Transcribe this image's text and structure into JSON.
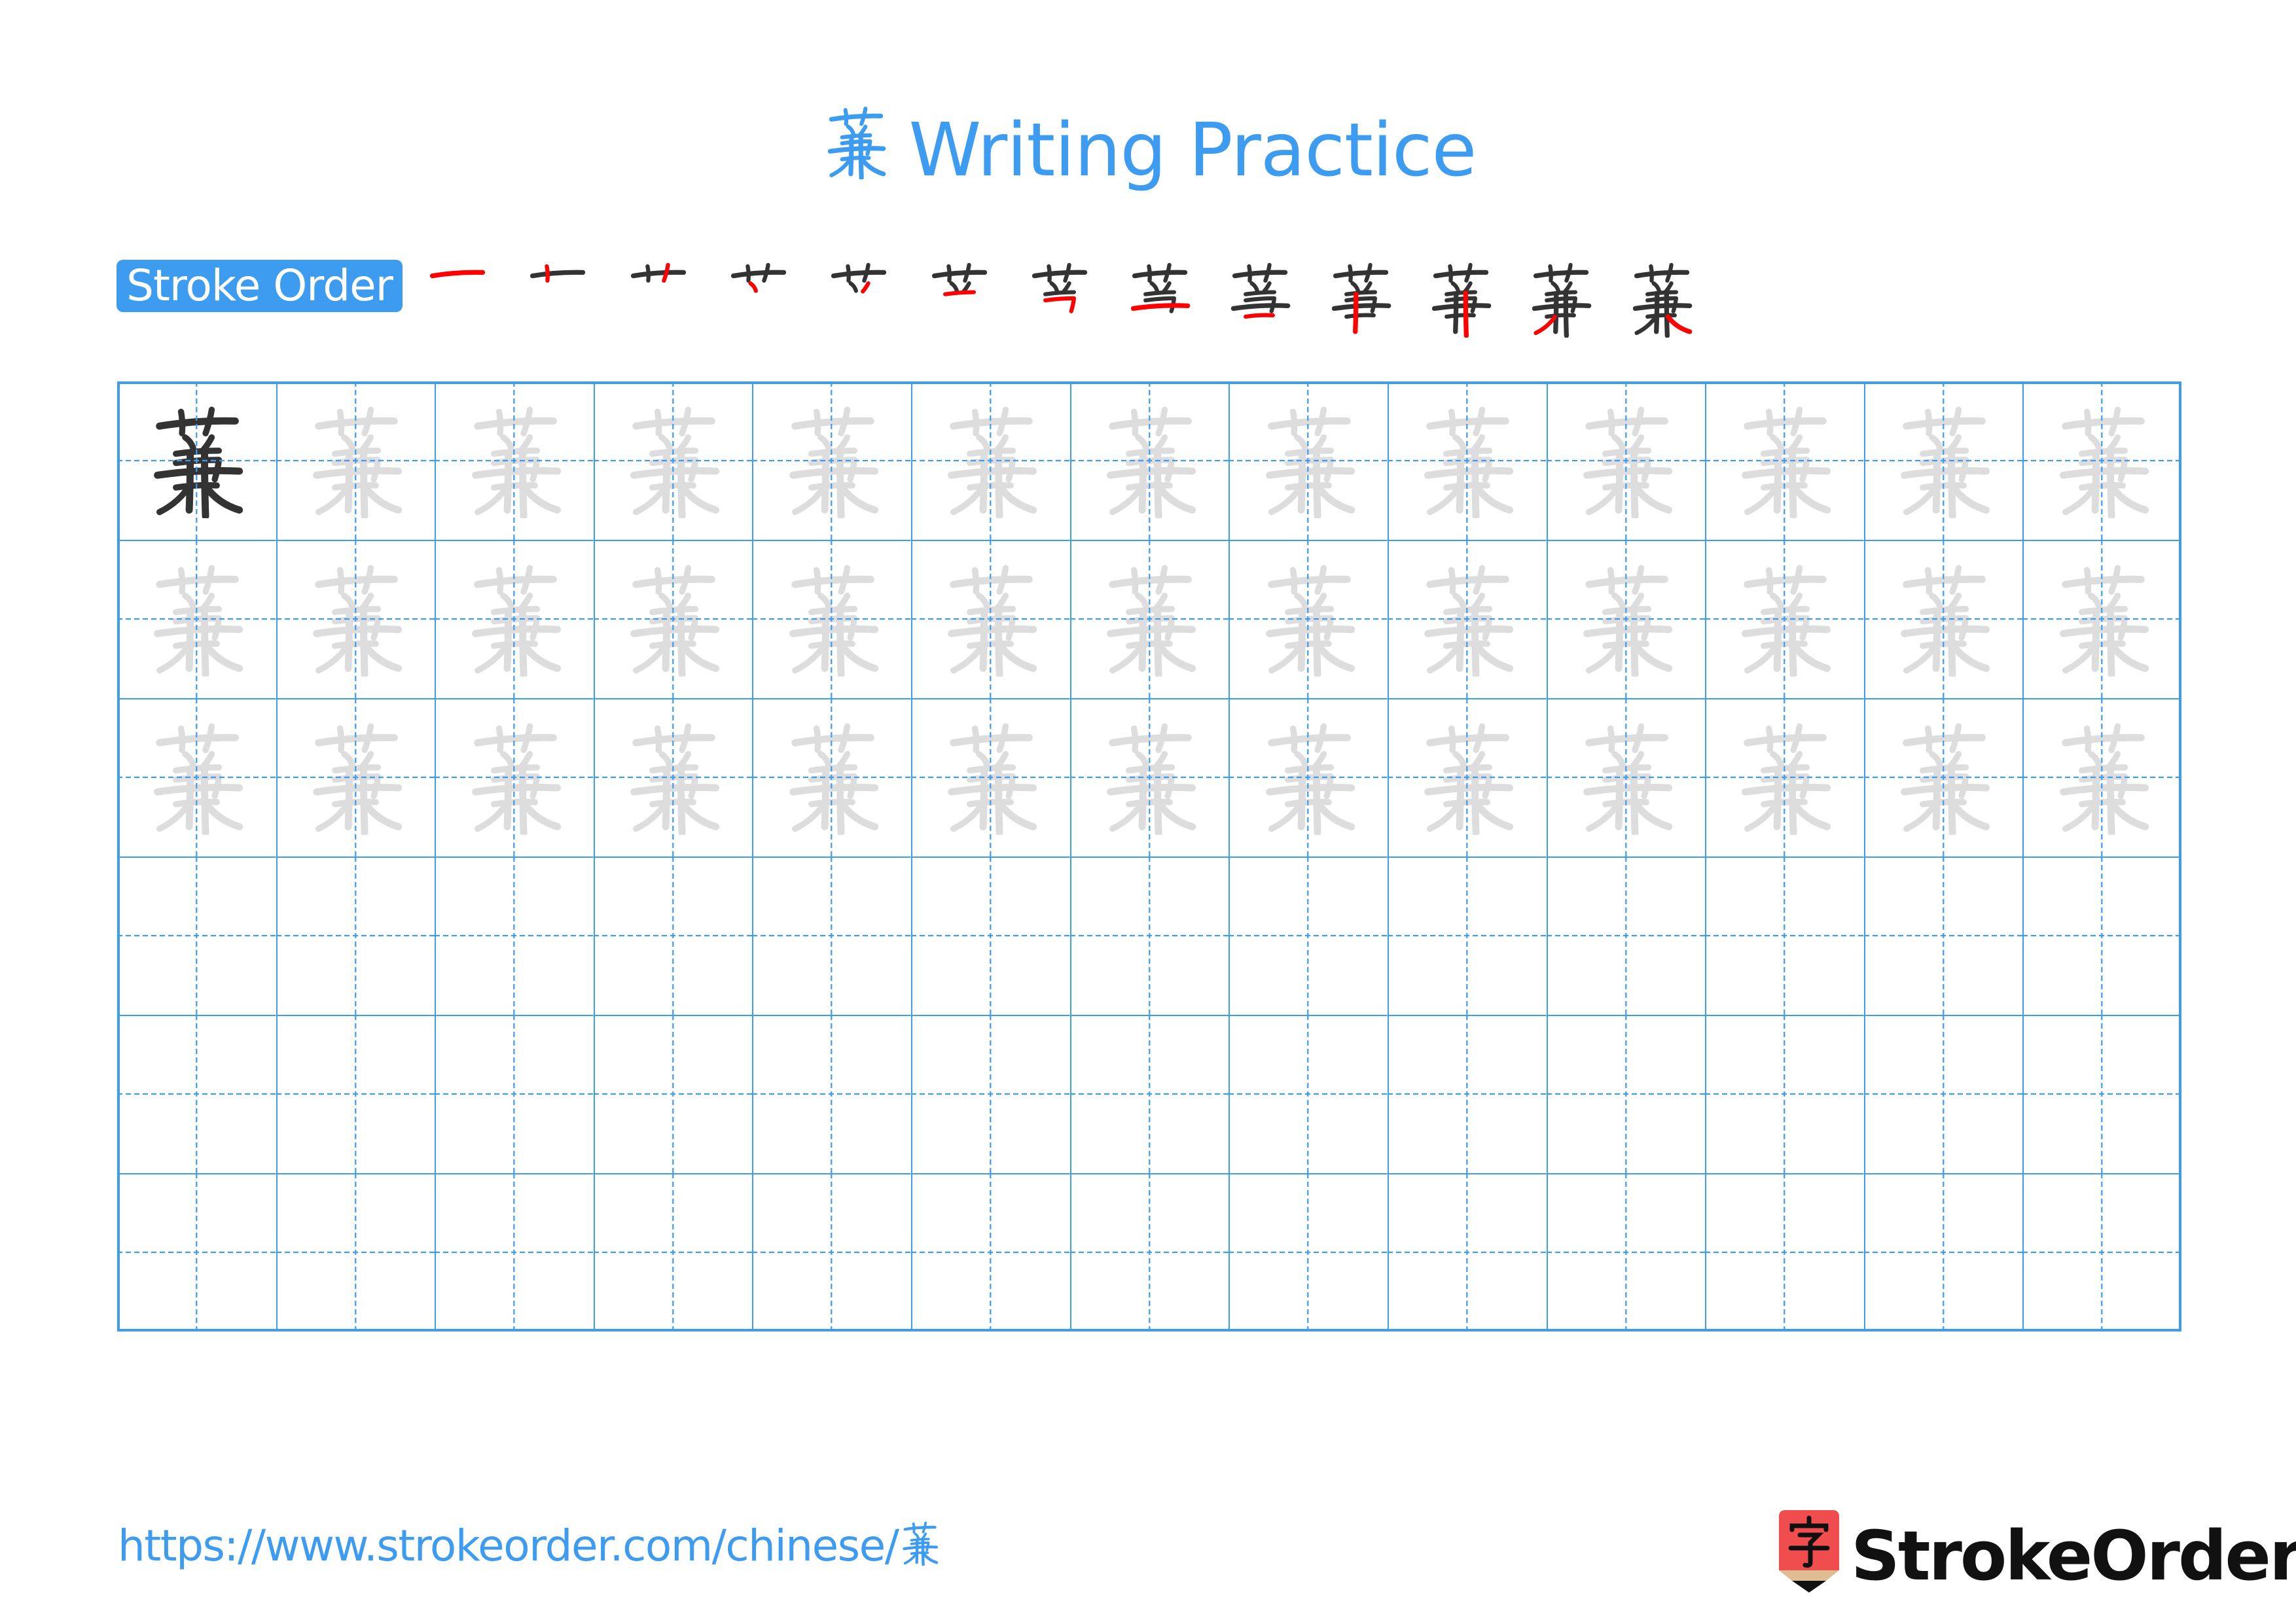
{
  "character": "蒹",
  "title": {
    "character": "蒹",
    "text": "Writing Practice"
  },
  "stroke_order": {
    "label": "Stroke Order",
    "stroke_count": 13,
    "steps": [
      {
        "step": 1,
        "strokes_shown": 1
      },
      {
        "step": 2,
        "strokes_shown": 2
      },
      {
        "step": 3,
        "strokes_shown": 3
      },
      {
        "step": 4,
        "strokes_shown": 4
      },
      {
        "step": 5,
        "strokes_shown": 5
      },
      {
        "step": 6,
        "strokes_shown": 6
      },
      {
        "step": 7,
        "strokes_shown": 7
      },
      {
        "step": 8,
        "strokes_shown": 8
      },
      {
        "step": 9,
        "strokes_shown": 9
      },
      {
        "step": 10,
        "strokes_shown": 10
      },
      {
        "step": 11,
        "strokes_shown": 11
      },
      {
        "step": 12,
        "strokes_shown": 12
      },
      {
        "step": 13,
        "strokes_shown": 13
      }
    ]
  },
  "practice_grid": {
    "columns": 13,
    "rows": [
      {
        "row": 1,
        "cells": "model-then-trace"
      },
      {
        "row": 2,
        "cells": "trace"
      },
      {
        "row": 3,
        "cells": "trace"
      },
      {
        "row": 4,
        "cells": "empty"
      },
      {
        "row": 5,
        "cells": "empty"
      },
      {
        "row": 6,
        "cells": "empty"
      }
    ]
  },
  "footer": {
    "url_prefix": "https://www.strokeorder.com/chinese/",
    "url_character": "蒹",
    "logo_icon_character": "字",
    "logo_text": "StrokeOrder"
  },
  "colors": {
    "accent": "#3d9bf0",
    "ink": "#333333",
    "trace": "#dddddd",
    "current_stroke": "#ff0000",
    "logo_red": "#f04e4e",
    "logo_tan": "#e0bc92",
    "logo_text": "#111111"
  }
}
